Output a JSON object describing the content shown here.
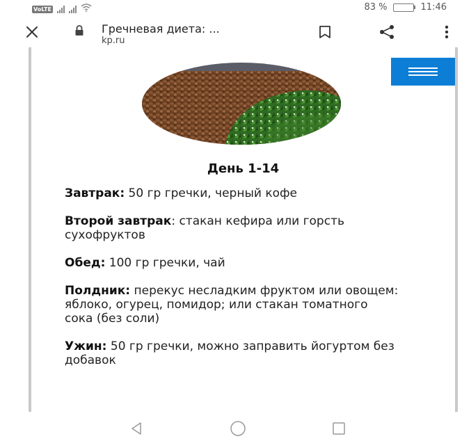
{
  "status_bar": {
    "network_badge": "VoLTE",
    "battery": "83 %",
    "battery_level_percent": 83,
    "time": "11:46"
  },
  "toolbar": {
    "page_title": "Гречневая диета: ...",
    "url": "kp.ru",
    "icons": {
      "close": "close-icon",
      "lock": "lock-icon",
      "bookmark": "bookmark-icon",
      "share": "share-icon",
      "menu": "more-vertical-icon"
    }
  },
  "article": {
    "menu_button_color": "#0c7ed6",
    "image_alt": "buckwheat-with-herbs",
    "day_heading": "День 1-14",
    "meals": [
      {
        "label": "Завтрак:",
        "text": " 50 гр гречки, черный кофе"
      },
      {
        "label": "Второй завтрак",
        "text": ": стакан кефира или горсть сухофруктов"
      },
      {
        "label": "Обед:",
        "text": " 100 гр гречки, чай"
      },
      {
        "label": "Полдник:",
        "text": " перекус несладким фруктом или овощем: яблоко, огурец, помидор; или стакан томатного сока (без соли)"
      },
      {
        "label": "Ужин:",
        "text": " 50 гр гречки, можно заправить йогуртом без добавок"
      }
    ]
  },
  "nav_bar": {
    "icons": [
      "back-icon",
      "home-icon",
      "recent-apps-icon"
    ]
  }
}
